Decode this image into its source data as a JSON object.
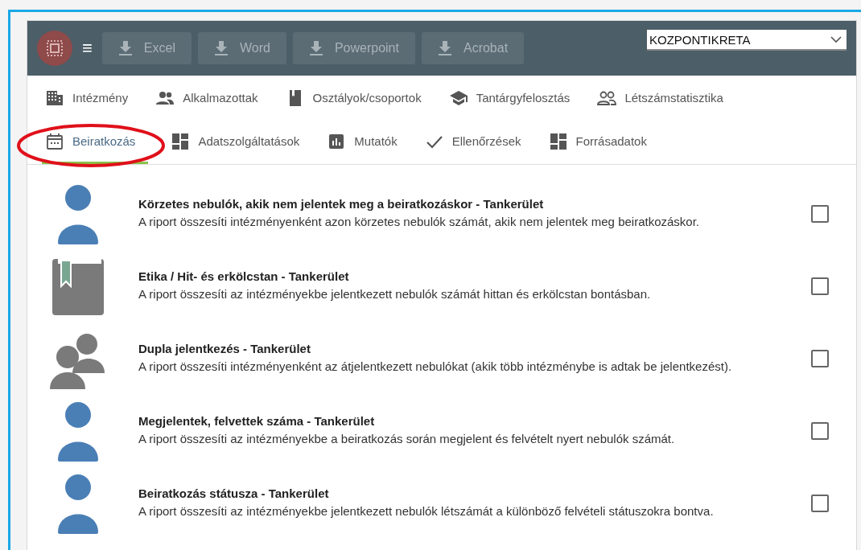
{
  "toolbar": {
    "menu_glyph": "≡",
    "buttons": [
      {
        "label": "Excel",
        "disabled": true
      },
      {
        "label": "Word",
        "disabled": true
      },
      {
        "label": "Powerpoint",
        "disabled": true
      },
      {
        "label": "Acrobat",
        "disabled": true
      }
    ],
    "select": {
      "value": "KOZPONTIKRETA"
    }
  },
  "tabs": [
    [
      {
        "label": "Intézmény",
        "kind": "building",
        "selected": false
      },
      {
        "label": "Alkalmazottak",
        "kind": "people",
        "selected": false
      },
      {
        "label": "Osztályok/csoportok",
        "kind": "book",
        "selected": false
      },
      {
        "label": "Tantárgyfelosztás",
        "kind": "school",
        "selected": false
      },
      {
        "label": "Létszámstatisztika",
        "kind": "people-outline",
        "selected": false
      }
    ],
    [
      {
        "label": "Beiratkozás",
        "kind": "calendar",
        "selected": true
      },
      {
        "label": "Adatszolgáltatások",
        "kind": "dashboard",
        "selected": false
      },
      {
        "label": "Mutatók",
        "kind": "chart",
        "selected": false
      },
      {
        "label": "Ellenőrzések",
        "kind": "check",
        "selected": false
      },
      {
        "label": "Forrásadatok",
        "kind": "dashboard",
        "selected": false
      }
    ]
  ],
  "reports": [
    {
      "kind": "person",
      "title": "Körzetes nebulók, akik nem jelentek meg a beiratkozáskor - Tankerület",
      "description": "A riport összesíti intézményenként azon körzetes nebulók számát, akik nem jelentek meg beiratkozáskor.",
      "checked": false
    },
    {
      "kind": "book",
      "title": "Etika / Hit- és erkölcstan - Tankerület",
      "description": "A riport összesíti az intézményekbe jelentkezett nebulók számát hittan és erkölcstan bontásban.",
      "checked": false
    },
    {
      "kind": "group",
      "title": "Dupla jelentkezés - Tankerület",
      "description": "A riport összesíti intézményenként az átjelentkezett nebulókat (akik több intézménybe is adtak be jelentkezést).",
      "checked": false
    },
    {
      "kind": "person",
      "title": "Megjelentek, felvettek száma - Tankerület",
      "description": "A riport összesíti az intézményekbe a beiratkozás során megjelent és felvételt nyert nebulók számát.",
      "checked": false
    },
    {
      "kind": "person",
      "title": "Beiratkozás státusza - Tankerület",
      "description": "A riport összesíti az intézményekbe jelentkezett nebulók létszámát a különböző felvételi státuszokra bontva.",
      "checked": false
    }
  ]
}
